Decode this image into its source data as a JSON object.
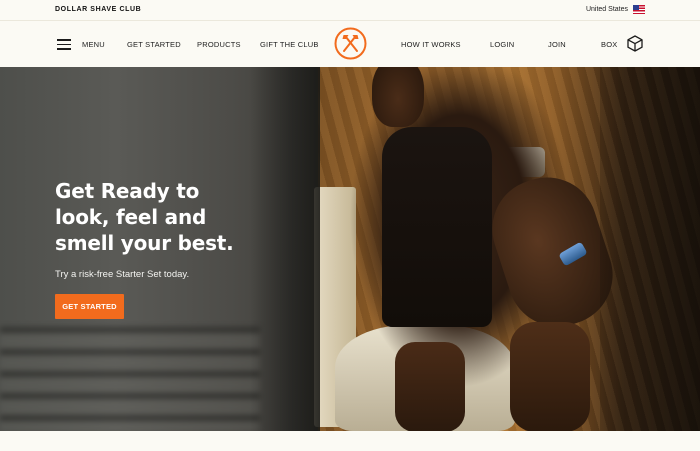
{
  "topbar": {
    "brand_name": "DOLLAR SHAVE CLUB",
    "country": "United States",
    "flag_icon": "us-flag-icon"
  },
  "nav": {
    "menu_label": "MENU",
    "get_started": "GET STARTED",
    "products": "PRODUCTS",
    "gift_the_club": "GIFT THE CLUB",
    "how_it_works": "HOW IT WORKS",
    "login": "LOGIN",
    "join": "JOIN",
    "box": "BOX",
    "logo_icon": "dsc-crossed-axes-logo",
    "box_icon": "box-cube-icon",
    "menu_icon": "hamburger-icon"
  },
  "hero": {
    "title_lines": [
      "Get Ready to",
      "look, feel and",
      "smell your best."
    ],
    "subtitle": "Try a risk-free Starter Set today.",
    "cta_label": "GET STARTED"
  },
  "colors": {
    "accent": "#f26b1d",
    "background": "#fbfaf4",
    "logo_orange": "#f26b1d"
  }
}
